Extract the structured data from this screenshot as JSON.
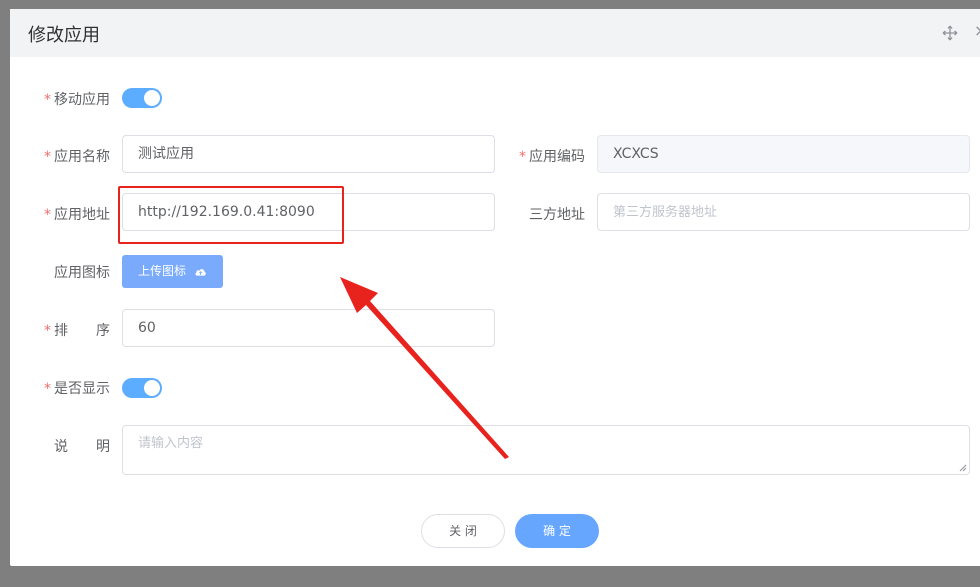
{
  "dialog": {
    "title": "修改应用",
    "move_icon": "move-icon",
    "close_icon": "close-icon",
    "close_glyph": "×"
  },
  "form": {
    "mobile_app": {
      "label": "移动应用",
      "required": "*",
      "on": true
    },
    "app_name": {
      "label": "应用名称",
      "required": "*",
      "value": "测试应用"
    },
    "app_code": {
      "label": "应用编码",
      "required": "*",
      "value": "XCXCS"
    },
    "app_address": {
      "label": "应用地址",
      "required": "*",
      "value": "http://192.169.0.41:8090"
    },
    "third_party_address": {
      "label": "三方地址",
      "placeholder": "第三方服务器地址"
    },
    "app_icon": {
      "label": "应用图标",
      "upload_label": "上传图标",
      "icon": "cloud-upload-icon"
    },
    "sort": {
      "label": "排　　序",
      "required": "*",
      "value": "60"
    },
    "display": {
      "label": "是否显示",
      "required": "*",
      "on": true
    },
    "description": {
      "label": "说　　明",
      "placeholder": "请输入内容"
    }
  },
  "footer": {
    "close_label": "关 闭",
    "confirm_label": "确 定"
  },
  "colors": {
    "primary": "#409eff",
    "required": "#f56c6c",
    "annotation": "#e8231e"
  }
}
